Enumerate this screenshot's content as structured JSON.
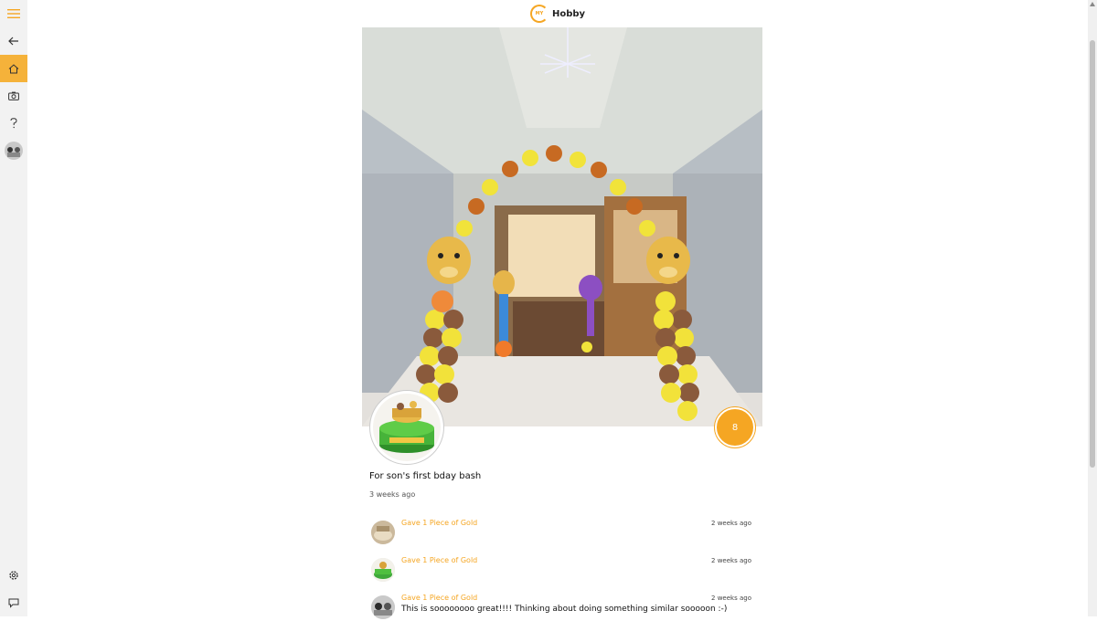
{
  "app": {
    "logo_mark": "MY",
    "title": "Hobby"
  },
  "colors": {
    "accent": "#f5a623",
    "sidebar_bg": "#f2f2f2",
    "active_bg": "#f5b23a"
  },
  "sidebar": {
    "items": [
      {
        "name": "hamburger-menu-icon"
      },
      {
        "name": "back-arrow-icon"
      },
      {
        "name": "home-icon",
        "active": true
      },
      {
        "name": "camera-icon"
      },
      {
        "name": "help-icon"
      },
      {
        "name": "profile-avatar"
      }
    ],
    "bottom_items": [
      {
        "name": "settings-gear-icon"
      },
      {
        "name": "feedback-icon"
      }
    ]
  },
  "post": {
    "caption": "For son's first bday bash",
    "time": "3 weeks ago",
    "gold_count": "8"
  },
  "activity": [
    {
      "action": "Gave 1 Piece of Gold",
      "time": "2 weeks ago",
      "message": ""
    },
    {
      "action": "Gave 1 Piece of Gold",
      "time": "2 weeks ago",
      "message": ""
    },
    {
      "action": "Gave 1 Piece of Gold",
      "time": "2 weeks ago",
      "message": "This is soooooooo great!!!! Thinking about doing something similar sooooon :-)"
    }
  ]
}
